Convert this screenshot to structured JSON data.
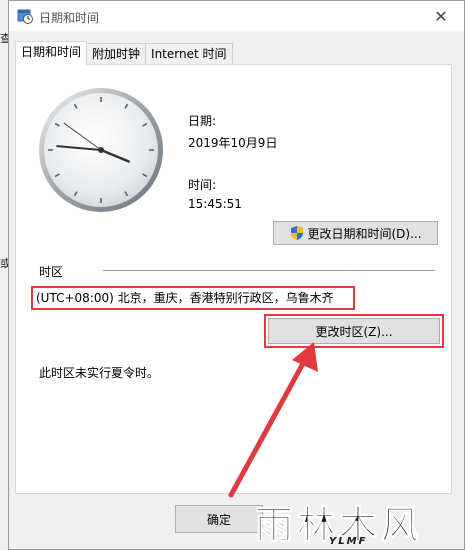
{
  "window": {
    "title": "日期和时间",
    "close_glyph": "✕"
  },
  "background_fragments": [
    "查",
    "或"
  ],
  "tabs": [
    {
      "label": "日期和时间",
      "active": true
    },
    {
      "label": "附加时钟",
      "active": false
    },
    {
      "label": "Internet 时间",
      "active": false
    }
  ],
  "date": {
    "label": "日期:",
    "value": "2019年10月9日"
  },
  "time": {
    "label": "时间:",
    "value": "15:45:51"
  },
  "change_datetime_button": "更改日期和时间(D)...",
  "timezone": {
    "section_label": "时区",
    "value": "(UTC+08:00) 北京，重庆，香港特别行政区，乌鲁木齐",
    "change_button": "更改时区(Z)...",
    "dst_note": "此时区未实行夏令时。"
  },
  "ok_button": "确定",
  "watermark": {
    "text": "雨林木风",
    "sub": "YLMF"
  },
  "colors": {
    "highlight_red": "#e0393e",
    "button_bg": "#e1e1e1",
    "window_bg": "#f0f0f0"
  }
}
